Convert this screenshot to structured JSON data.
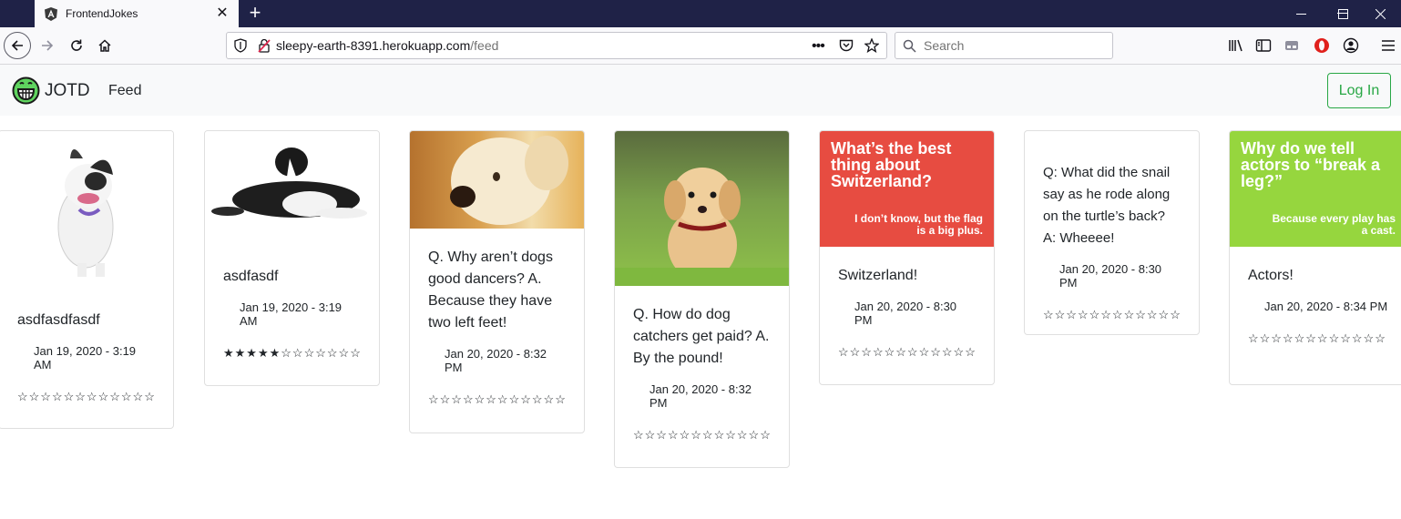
{
  "browser": {
    "tab_title": "FrontendJokes",
    "url_domain": "sleepy-earth-8391.herokuapp.com",
    "url_path": "/feed",
    "search_placeholder": "Search",
    "colors": {
      "tabbar": "#1f2247",
      "toolbar": "#f9f9fb"
    }
  },
  "app": {
    "brand": "JOTD",
    "nav_feed": "Feed",
    "login_label": "Log In",
    "accent": "#28a745"
  },
  "cards": [
    {
      "text": "asdfasdfasdf",
      "date": "Jan 19, 2020 - 3:19 AM",
      "rating": 0,
      "stars": "☆☆☆☆☆☆☆☆☆☆☆☆",
      "image": "french-bulldog"
    },
    {
      "text": "asdfasdf",
      "date": "Jan 19, 2020 - 3:19 AM",
      "rating": 5,
      "stars": "★★★★★☆☆☆☆☆☆☆",
      "image": "border-collie"
    },
    {
      "text": "Q. Why aren’t dogs good dancers? A. Because they have two left feet!",
      "date": "Jan 20, 2020 - 8:32 PM",
      "rating": 0,
      "stars": "☆☆☆☆☆☆☆☆☆☆☆☆",
      "image": "labrador-puppy"
    },
    {
      "text": "Q. How do dog catchers get paid? A. By the pound!",
      "date": "Jan 20, 2020 - 8:32 PM",
      "rating": 0,
      "stars": "☆☆☆☆☆☆☆☆☆☆☆☆",
      "image": "golden-puppy"
    },
    {
      "text": "Switzerland!",
      "date": "Jan 20, 2020 - 8:30 PM",
      "rating": 0,
      "stars": "☆☆☆☆☆☆☆☆☆☆☆☆",
      "image": "switzerland-meme",
      "meme_title": "What’s the best thing about Switzerland?",
      "meme_answer": "I don’t know, but the flag is a big plus."
    },
    {
      "text": "Q: What did the snail say as he rode along on the turtle’s back? A: Wheeee!",
      "date": "Jan 20, 2020 - 8:30 PM",
      "rating": 0,
      "stars": "☆☆☆☆☆☆☆☆☆☆☆☆",
      "image": null
    },
    {
      "text": "Actors!",
      "date": "Jan 20, 2020 - 8:34 PM",
      "rating": 0,
      "stars": "☆☆☆☆☆☆☆☆☆☆☆☆",
      "image": "actors-meme",
      "meme_title": "Why do we tell actors to “break a leg?”",
      "meme_answer": "Because every play has a cast."
    }
  ]
}
